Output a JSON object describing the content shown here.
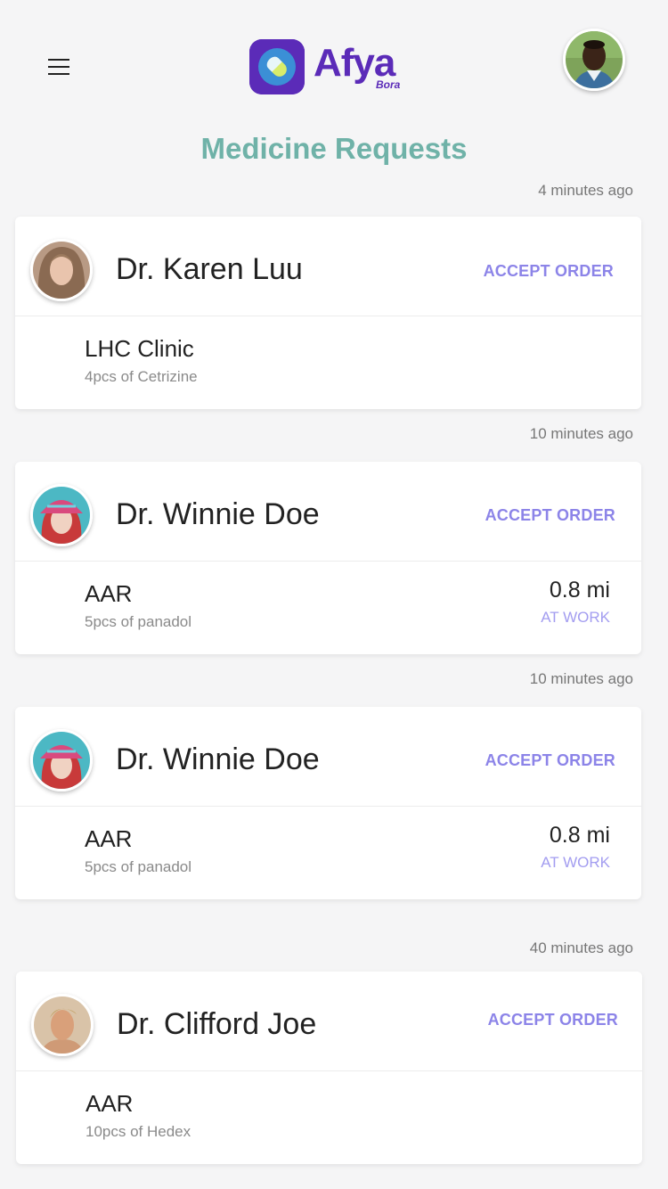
{
  "header": {
    "logo_text": "Afya",
    "logo_sub": "Bora"
  },
  "page_title": "Medicine Requests",
  "requests": [
    {
      "time": "4 minutes ago",
      "doctor": "Dr. Karen Luu",
      "action": "ACCEPT ORDER",
      "clinic": "LHC Clinic",
      "order": "4pcs of Cetrizine",
      "distance": "",
      "location": ""
    },
    {
      "time": "10 minutes ago",
      "doctor": "Dr. Winnie Doe",
      "action": "ACCEPT ORDER",
      "clinic": "AAR",
      "order": "5pcs of panadol",
      "distance": "0.8 mi",
      "location": "AT WORK"
    },
    {
      "time": "10 minutes ago",
      "doctor": "Dr. Winnie Doe",
      "action": "ACCEPT ORDER",
      "clinic": "AAR",
      "order": "5pcs of panadol",
      "distance": "0.8 mi",
      "location": "AT WORK"
    },
    {
      "time": "40 minutes ago",
      "doctor": "Dr. Clifford Joe",
      "action": "ACCEPT ORDER",
      "clinic": "AAR",
      "order": "10pcs of Hedex",
      "distance": "",
      "location": ""
    }
  ],
  "colors": {
    "brand": "#5b2bb8",
    "title": "#6fb2a8",
    "accent": "#8c84e8"
  }
}
